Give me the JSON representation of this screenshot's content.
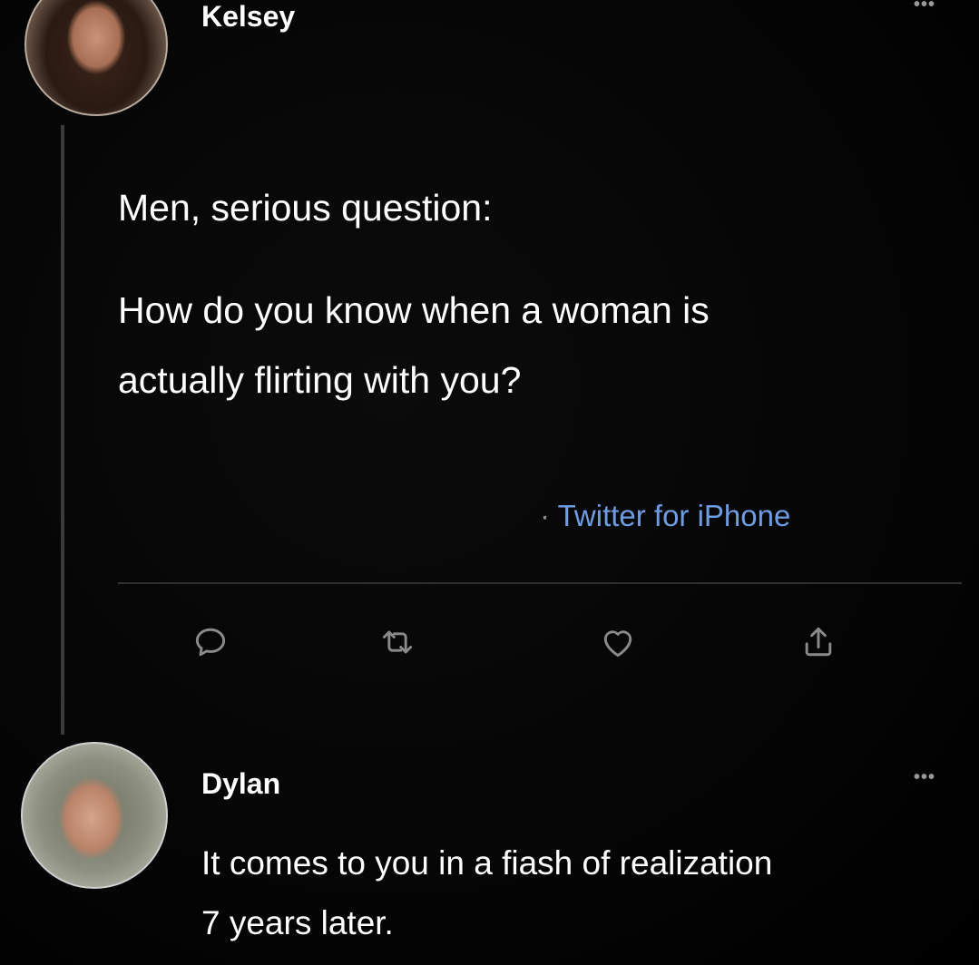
{
  "tweet": {
    "author": "Kelsey",
    "lines": [
      "Men, serious question:",
      "How do you know when a woman is",
      "actually flirting with you?"
    ],
    "source_prefix": "· ",
    "source_link": "Twitter for iPhone",
    "more_label": "•••",
    "actions": {
      "reply_icon": "speech-bubble-icon",
      "retweet_icon": "retweet-icon",
      "like_icon": "heart-icon",
      "share_icon": "share-icon"
    }
  },
  "reply": {
    "author": "Dylan",
    "lines": [
      "It comes to you in a fiash of realization",
      "7 years later."
    ],
    "more_label": "•••"
  },
  "colors": {
    "background": "#000000",
    "text": "#ffffff",
    "link": "#6f9ce0",
    "icon": "#8a8a8a",
    "divider": "#2f2f2f"
  }
}
